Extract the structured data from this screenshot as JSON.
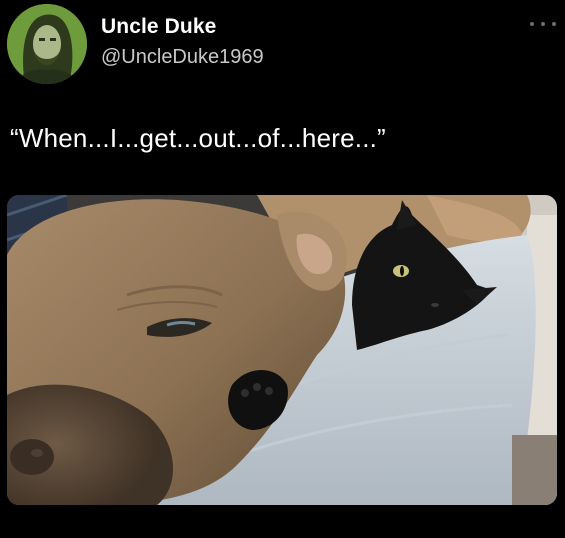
{
  "tweet": {
    "author": {
      "display_name": "Uncle Duke",
      "handle": "@UncleDuke1969",
      "avatar_icon": "profile-avatar"
    },
    "text": "“When...I...get...out...of...here...”",
    "more_icon": "more-horizontal-icon",
    "media": {
      "kind": "photo"
    }
  },
  "colors": {
    "background": "#000000",
    "text_primary": "#ffffff",
    "text_secondary": "#c9c9c9",
    "avatar_bg": "#6d9a3a"
  }
}
